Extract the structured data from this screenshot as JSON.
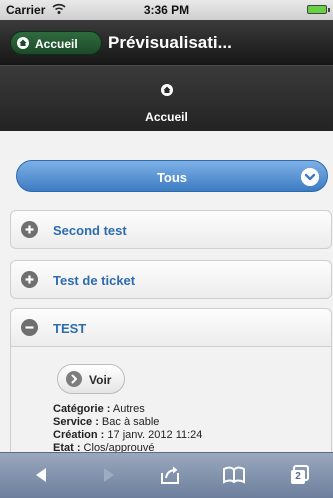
{
  "status_bar": {
    "carrier": "Carrier",
    "time": "3:36 PM"
  },
  "header": {
    "back_label": "Accueil",
    "title": "Prévisualisati..."
  },
  "navbar": {
    "home_label": "Accueil"
  },
  "filter": {
    "selected": "Tous"
  },
  "tickets": [
    {
      "label": "Second test",
      "state": "collapsed"
    },
    {
      "label": "Test de ticket",
      "state": "collapsed"
    },
    {
      "label": "TEST",
      "state": "expanded"
    }
  ],
  "ticket_detail": {
    "voir_label": "Voir",
    "fields": [
      {
        "label": "Catégorie :",
        "value": " Autres"
      },
      {
        "label": "Service :",
        "value": " Bac à sable"
      },
      {
        "label": "Création :",
        "value": " 17 janv. 2012 11:24"
      },
      {
        "label": "Etat :",
        "value": " Clos/approuvé"
      }
    ]
  },
  "toolbar": {
    "tabs_count": "2"
  },
  "colors": {
    "accent_blue": "#3e7cc3",
    "back_button_green": "#2f6b3e",
    "link_blue": "#2e6cb0"
  },
  "icons": [
    "wifi-icon",
    "battery-icon",
    "home-icon",
    "chevron-down-icon",
    "plus-circle-icon",
    "minus-circle-icon",
    "arrow-right-icon",
    "back-arrow-icon",
    "forward-arrow-icon",
    "share-icon",
    "bookmarks-icon",
    "tabs-icon"
  ]
}
